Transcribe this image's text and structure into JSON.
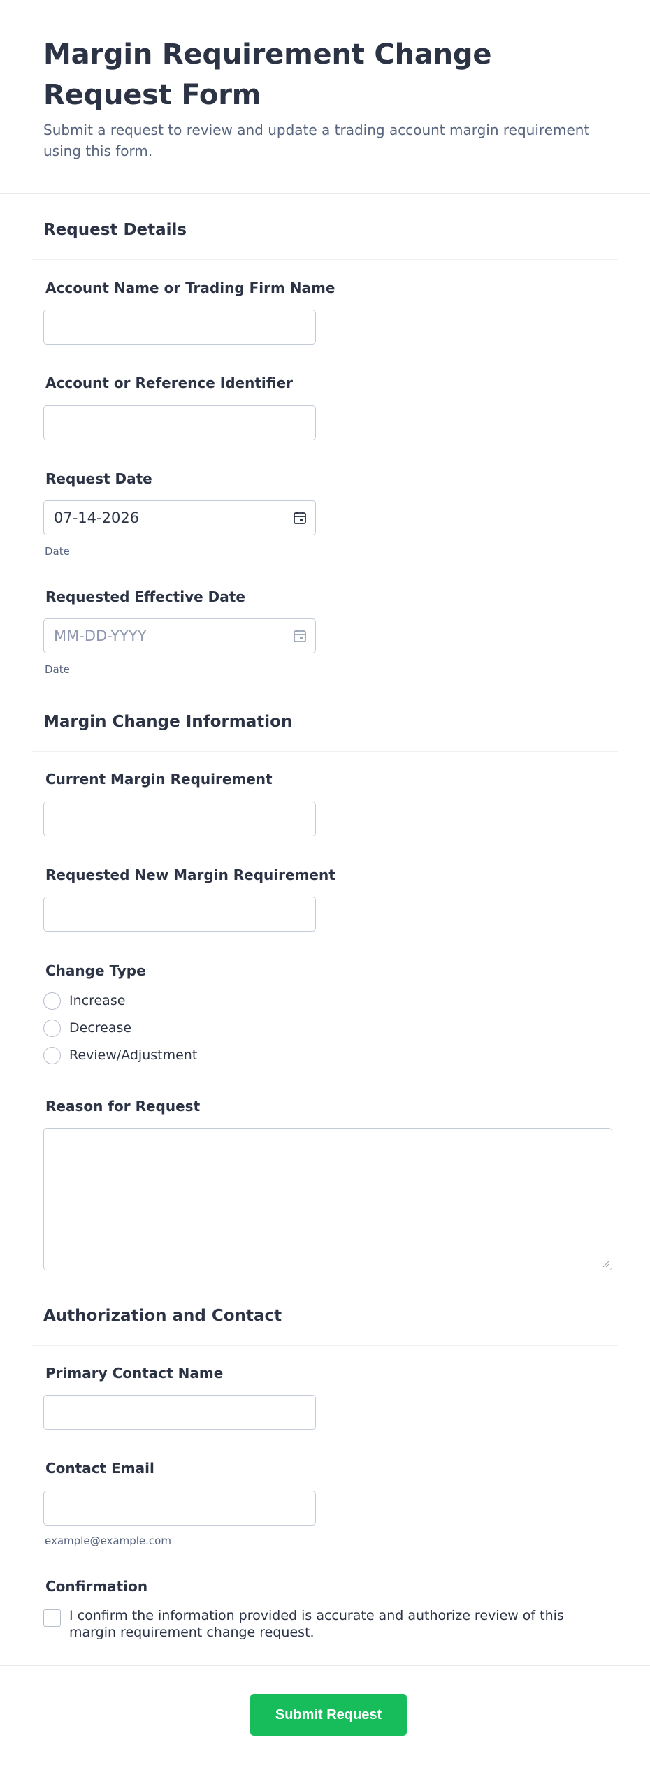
{
  "form": {
    "title": "Margin Requirement Change Request Form",
    "subtitle": "Submit a request to review and update a trading account margin requirement using this form."
  },
  "sections": {
    "request_details": {
      "title": "Request Details",
      "account_name_label": "Account Name or Trading Firm Name",
      "account_name_value": "",
      "account_id_label": "Account or Reference Identifier",
      "account_id_value": "",
      "request_date_label": "Request Date",
      "request_date_value": "07-14-2026",
      "request_date_sublabel": "Date",
      "effective_date_label": "Requested Effective Date",
      "effective_date_placeholder": "MM-DD-YYYY",
      "effective_date_sublabel": "Date"
    },
    "margin_change": {
      "title": "Margin Change Information",
      "current_margin_label": "Current Margin Requirement",
      "current_margin_value": "",
      "new_margin_label": "Requested New Margin Requirement",
      "new_margin_value": "",
      "change_type_label": "Change Type",
      "change_type_options": [
        "Increase",
        "Decrease",
        "Review/Adjustment"
      ],
      "reason_label": "Reason for Request",
      "reason_value": ""
    },
    "authorization": {
      "title": "Authorization and Contact",
      "contact_name_label": "Primary Contact Name",
      "contact_name_value": "",
      "contact_email_label": "Contact Email",
      "contact_email_value": "",
      "contact_email_sublabel": "example@example.com",
      "confirmation_label": "Confirmation",
      "confirmation_text": "I confirm the information provided is accurate and authorize review of this margin requirement change request.",
      "confirmation_checked": false
    }
  },
  "footer": {
    "submit_label": "Submit Request"
  },
  "icons": {
    "date_picker": "calendar-icon"
  },
  "colors": {
    "accent": "#18bd5b",
    "text": "#2c3345",
    "muted": "#57647e",
    "border": "#c3cad8"
  }
}
